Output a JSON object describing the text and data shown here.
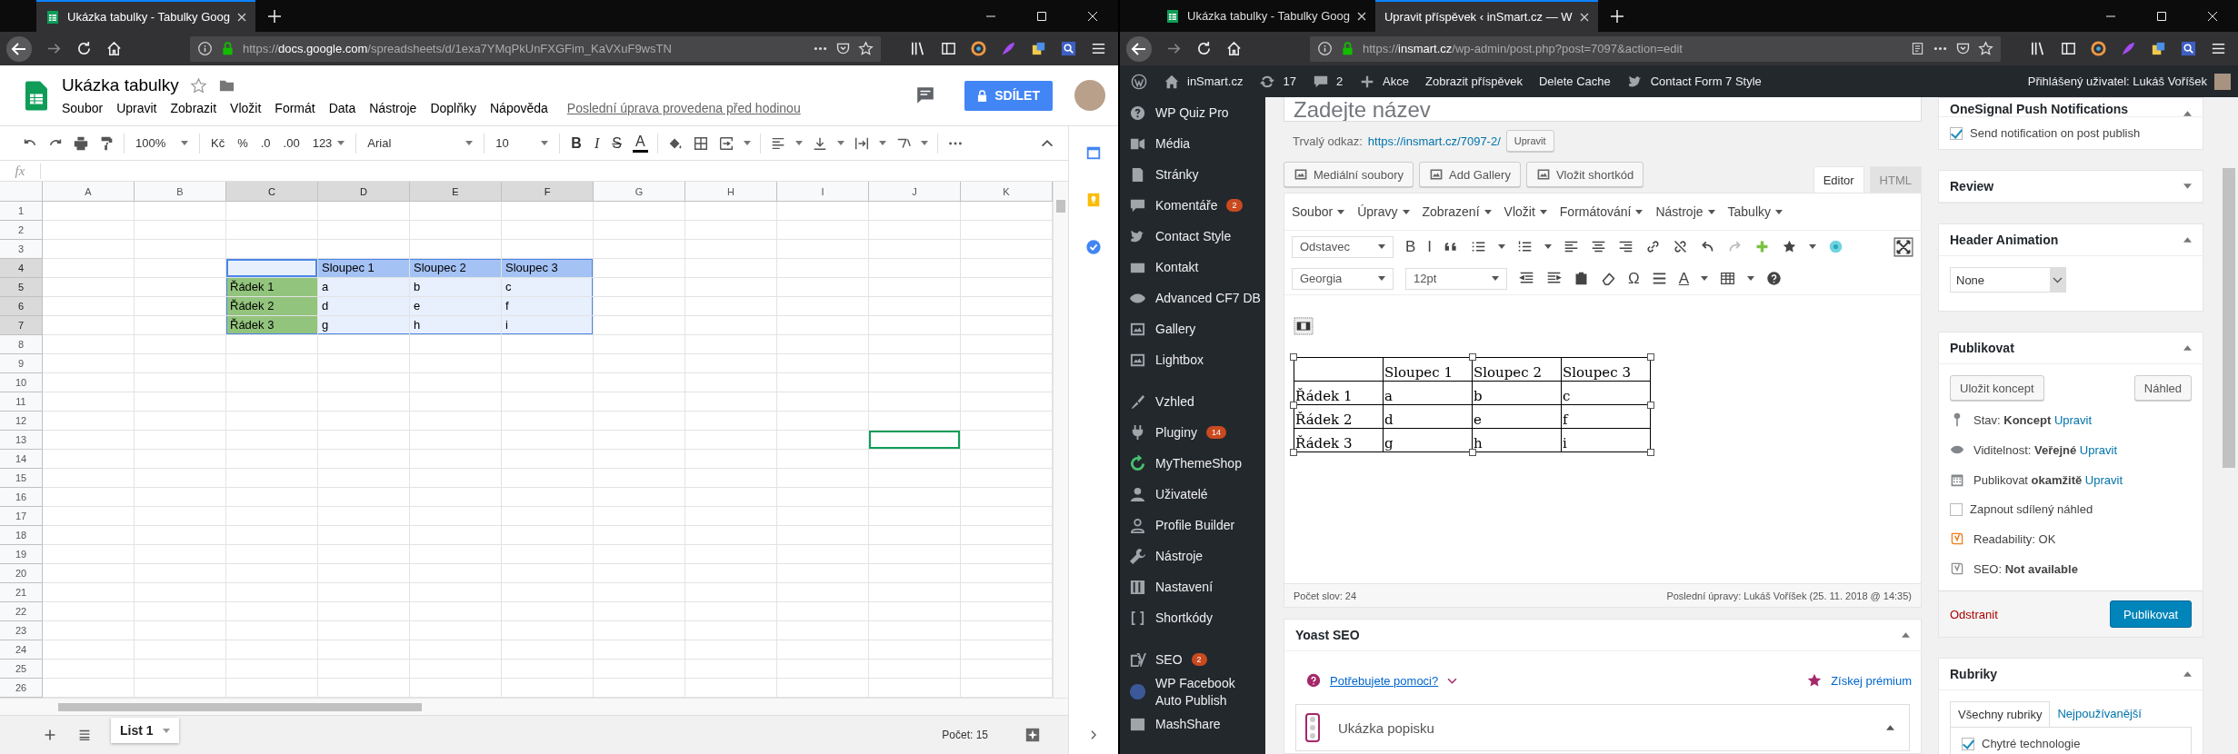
{
  "left_window": {
    "tabs": [
      {
        "title": "Ukázka tabulky - Tabulky Goog",
        "selected": true,
        "kind": "sheets"
      }
    ],
    "address": {
      "scheme": "https://",
      "host": "docs.google.com",
      "path": "/spreadsheets/d/1exa7YMqPkUnFXGFim_KaVXuF9wsTN"
    },
    "doc_title": "Ukázka tabulky",
    "menu": [
      "Soubor",
      "Upravit",
      "Zobrazit",
      "Vložit",
      "Formát",
      "Data",
      "Nástroje",
      "Doplňky",
      "Nápověda"
    ],
    "last_edit": "Poslední úprava provedena před hodinou",
    "share_button": "SDÍLET",
    "toolbar": {
      "zoom": "100%",
      "currency": "Kč",
      "percent": "%",
      "decrease_decimals": ".0",
      "increase_decimals": ".00",
      "number_format": "123",
      "font": "Arial",
      "font_size": "10",
      "bold": "B",
      "italic": "I",
      "strikethrough": "S",
      "text_color": "A"
    },
    "formula_label": "fx",
    "columns": [
      {
        "label": "A",
        "selected": false
      },
      {
        "label": "B",
        "selected": false
      },
      {
        "label": "C",
        "selected": true
      },
      {
        "label": "D",
        "selected": true
      },
      {
        "label": "E",
        "selected": true
      },
      {
        "label": "F",
        "selected": true
      },
      {
        "label": "G",
        "selected": false
      },
      {
        "label": "H",
        "selected": false
      },
      {
        "label": "I",
        "selected": false
      },
      {
        "label": "J",
        "selected": false
      },
      {
        "label": "K",
        "selected": false
      }
    ],
    "rows": [
      {
        "label": "1",
        "selected": false
      },
      {
        "label": "2",
        "selected": false
      },
      {
        "label": "3",
        "selected": false
      },
      {
        "label": "4",
        "selected": true,
        "cells": [
          {
            "selected": false,
            "active": false,
            "outlined": false
          },
          {
            "selected": false,
            "active": false,
            "outlined": false
          },
          {
            "selected": true,
            "active": true,
            "outlined": false
          },
          {
            "text": "Sloupec 1",
            "color": "#a4c2f4",
            "selected": true,
            "active": false,
            "outlined": false
          },
          {
            "text": "Sloupec 2",
            "color": "#a4c2f4",
            "selected": true,
            "active": false,
            "outlined": false
          },
          {
            "text": "Sloupec 3",
            "color": "#a4c2f4",
            "selected": true,
            "active": false,
            "outlined": false
          },
          {
            "selected": false,
            "active": false,
            "outlined": false
          },
          {
            "selected": false,
            "active": false,
            "outlined": false
          },
          {
            "selected": false,
            "active": false,
            "outlined": false
          },
          {
            "selected": false,
            "active": false,
            "outlined": false
          },
          {
            "selected": false,
            "active": false,
            "outlined": false
          }
        ]
      },
      {
        "label": "5",
        "selected": true,
        "cells": [
          {
            "selected": false,
            "active": false,
            "outlined": false
          },
          {
            "selected": false,
            "active": false,
            "outlined": false
          },
          {
            "text": "Řádek 1",
            "color": "#93c47d",
            "selected": true,
            "active": false,
            "outlined": false
          },
          {
            "text": "a",
            "selected": true,
            "active": false,
            "outlined": false
          },
          {
            "text": "b",
            "selected": true,
            "active": false,
            "outlined": false
          },
          {
            "text": "c",
            "selected": true,
            "active": false,
            "outlined": false
          },
          {
            "selected": false,
            "active": false,
            "outlined": false
          },
          {
            "selected": false,
            "active": false,
            "outlined": false
          },
          {
            "selected": false,
            "active": false,
            "outlined": false
          },
          {
            "selected": false,
            "active": false,
            "outlined": false
          },
          {
            "selected": false,
            "active": false,
            "outlined": false
          }
        ]
      },
      {
        "label": "6",
        "selected": true,
        "cells": [
          {
            "selected": false,
            "active": false,
            "outlined": false
          },
          {
            "selected": false,
            "active": false,
            "outlined": false
          },
          {
            "text": "Řádek 2",
            "color": "#93c47d",
            "selected": true,
            "active": false,
            "outlined": false
          },
          {
            "text": "d",
            "selected": true,
            "active": false,
            "outlined": false
          },
          {
            "text": "e",
            "selected": true,
            "active": false,
            "outlined": false
          },
          {
            "text": "f",
            "selected": true,
            "active": false,
            "outlined": false
          },
          {
            "selected": false,
            "active": false,
            "outlined": false
          },
          {
            "selected": false,
            "active": false,
            "outlined": false
          },
          {
            "selected": false,
            "active": false,
            "outlined": false
          },
          {
            "selected": false,
            "active": false,
            "outlined": false
          },
          {
            "selected": false,
            "active": false,
            "outlined": false
          }
        ]
      },
      {
        "label": "7",
        "selected": true,
        "cells": [
          {
            "selected": false,
            "active": false,
            "outlined": false
          },
          {
            "selected": false,
            "active": false,
            "outlined": false
          },
          {
            "text": "Řádek 3",
            "color": "#93c47d",
            "selected": true,
            "active": false,
            "outlined": false
          },
          {
            "text": "g",
            "selected": true,
            "active": false,
            "outlined": false
          },
          {
            "text": "h",
            "selected": true,
            "active": false,
            "outlined": false
          },
          {
            "text": "i",
            "selected": true,
            "active": false,
            "outlined": false
          },
          {
            "selected": false,
            "active": false,
            "outlined": false
          },
          {
            "selected": false,
            "active": false,
            "outlined": false
          },
          {
            "selected": false,
            "active": false,
            "outlined": false
          },
          {
            "selected": false,
            "active": false,
            "outlined": false
          },
          {
            "selected": false,
            "active": false,
            "outlined": false
          }
        ]
      },
      {
        "label": "8",
        "selected": false
      },
      {
        "label": "9",
        "selected": false
      },
      {
        "label": "10",
        "selected": false
      },
      {
        "label": "11",
        "selected": false
      },
      {
        "label": "12",
        "selected": false
      },
      {
        "label": "13",
        "selected": false,
        "cells": [
          {
            "selected": false,
            "active": false,
            "outlined": false
          },
          {
            "selected": false,
            "active": false,
            "outlined": false
          },
          {
            "selected": false,
            "active": false,
            "outlined": false
          },
          {
            "selected": false,
            "active": false,
            "outlined": false
          },
          {
            "selected": false,
            "active": false,
            "outlined": false
          },
          {
            "selected": false,
            "active": false,
            "outlined": false
          },
          {
            "selected": false,
            "active": false,
            "outlined": false
          },
          {
            "selected": false,
            "active": false,
            "outlined": false
          },
          {
            "selected": false,
            "active": false,
            "outlined": false
          },
          {
            "selected": false,
            "active": false,
            "outlined": true
          },
          {
            "selected": false,
            "active": false,
            "outlined": false
          }
        ]
      },
      {
        "label": "14",
        "selected": false
      },
      {
        "label": "15",
        "selected": false
      },
      {
        "label": "16",
        "selected": false
      },
      {
        "label": "17",
        "selected": false
      },
      {
        "label": "18",
        "selected": false
      },
      {
        "label": "19",
        "selected": false
      },
      {
        "label": "20",
        "selected": false
      },
      {
        "label": "21",
        "selected": false
      },
      {
        "label": "22",
        "selected": false
      },
      {
        "label": "23",
        "selected": false
      },
      {
        "label": "24",
        "selected": false
      },
      {
        "label": "25",
        "selected": false
      },
      {
        "label": "26",
        "selected": false
      }
    ],
    "sheet_tab": "List 1",
    "status": "Počet: 15"
  },
  "right_window": {
    "tabs": [
      {
        "title": "Ukázka tabulky - Tabulky Goog",
        "selected": false,
        "kind": "sheets"
      },
      {
        "title": "Upravit příspěvek ‹ inSmart.cz — W",
        "selected": true,
        "kind": "plain"
      }
    ],
    "address": {
      "scheme": "https://",
      "host": "insmart.cz",
      "path": "/wp-admin/post.php?post=7097&action=edit"
    },
    "admin_bar": {
      "site": "inSmart.cz",
      "updates": "17",
      "comments": "2",
      "new": "Akce",
      "links": [
        "Zobrazit příspěvek",
        "Delete Cache"
      ],
      "plugin": "Contact Form 7 Style",
      "user": "Přihlášený uživatel: Lukáš Voříšek"
    },
    "sidebar": [
      {
        "items": [
          {
            "label": "WP Quiz Pro",
            "kind": "quiz"
          },
          {
            "label": "Média",
            "kind": "media"
          },
          {
            "label": "Stránky",
            "kind": "pages"
          },
          {
            "label": "Komentáře",
            "kind": "comments",
            "badge": "2"
          },
          {
            "label": "Contact Style",
            "kind": "bird"
          },
          {
            "label": "Kontakt",
            "kind": "mail"
          },
          {
            "label": "Advanced CF7 DB",
            "kind": "eye"
          },
          {
            "label": "Gallery",
            "kind": "gallery"
          },
          {
            "label": "Lightbox",
            "kind": "gallery"
          }
        ]
      },
      {
        "items": [
          {
            "label": "Vzhled",
            "kind": "brush"
          },
          {
            "label": "Pluginy",
            "kind": "plug",
            "badge": "14"
          },
          {
            "label": "MyThemeShop",
            "kind": "refresh"
          },
          {
            "label": "Uživatelé",
            "kind": "user"
          },
          {
            "label": "Profile Builder",
            "kind": "person"
          },
          {
            "label": "Nástroje",
            "kind": "wrench"
          },
          {
            "label": "Nastavení",
            "kind": "sliders"
          },
          {
            "label": "Shortkódy",
            "kind": "brackets"
          }
        ]
      },
      {
        "items": [
          {
            "label": "SEO",
            "kind": "logo",
            "badge": "2"
          },
          {
            "label": "WP Facebook Auto Publish",
            "kind": "circle"
          },
          {
            "label": "MashShare",
            "kind": "square"
          }
        ]
      }
    ],
    "post": {
      "title_placeholder": "Zadejte název",
      "permalink_label": "Trvalý odkaz:",
      "permalink": "https://insmart.cz/7097-2/",
      "permalink_button": "Upravit",
      "media_buttons": [
        "Mediální soubory",
        "Add Gallery",
        "Vložit shortkód"
      ],
      "editor_tabs": [
        {
          "label": "Editor",
          "selected": true
        },
        {
          "label": "HTML",
          "selected": false
        }
      ],
      "menu": [
        "Soubor",
        "Úpravy",
        "Zobrazení",
        "Vložit",
        "Formátování",
        "Nástroje",
        "Tabulky"
      ],
      "format": "Odstavec",
      "font": "Georgia",
      "size": "12pt",
      "bold": "B",
      "italic": "I",
      "special_char": "Ω",
      "text_color": "A",
      "table": {
        "columns": [
          "Sloupec 1",
          "Sloupec 2",
          "Sloupec 3"
        ],
        "rows": [
          {
            "label": "Řádek 1",
            "cells": [
              "a",
              "b",
              "c"
            ]
          },
          {
            "label": "Řádek 2",
            "cells": [
              "d",
              "e",
              "f"
            ]
          },
          {
            "label": "Řádek 3",
            "cells": [
              "g",
              "h",
              "i"
            ]
          }
        ]
      },
      "word_count": "Počet slov: 24",
      "last_edit": "Poslední úpravy: Lukáš Voříšek (25. 11. 2018 @ 14:35)"
    },
    "yoast": {
      "title": "Yoast SEO",
      "help_link": "Potřebujete pomoci?",
      "premium_link": "Získej prémium",
      "section": "Ukázka popisku"
    },
    "onesignal": {
      "title": "OneSignal Push Notifications",
      "option": "Send notification on post publish",
      "checked": true
    },
    "review": {
      "title": "Review"
    },
    "header_animation": {
      "title": "Header Animation",
      "value": "None"
    },
    "publish": {
      "title": "Publikovat",
      "save_button": "Uložit koncept",
      "preview_button": "Náhled",
      "meta_rows": [
        {
          "kind": "pin",
          "text": "Stav: **Koncept**",
          "link": "Upravit"
        },
        {
          "kind": "eye",
          "text": "Viditelnost: **Veřejné**",
          "link": "Upravit"
        },
        {
          "kind": "calendar",
          "text": "Publikovat **okamžitě**",
          "link": "Upravit"
        }
      ],
      "share_preview": {
        "label": "Zapnout sdílený náhled",
        "checked": false
      },
      "scores": [
        {
          "text": "Readability: OK",
          "color": "#ee7c1b"
        },
        {
          "text": "SEO: **Not available**",
          "color": "#8f8f8f"
        }
      ],
      "delete_link": "Odstranit",
      "publish_button": "Publikovat"
    },
    "categories": {
      "title": "Rubriky",
      "tabs": [
        {
          "label": "Všechny rubriky",
          "selected": true
        },
        {
          "label": "Nejpoužívanější",
          "selected": false
        }
      ],
      "items": [
        {
          "label": "Chytré technologie",
          "checked": true
        }
      ]
    }
  }
}
